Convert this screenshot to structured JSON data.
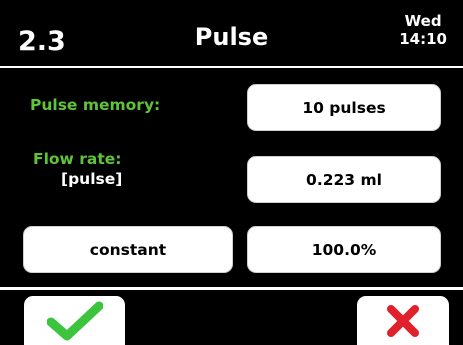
{
  "header": {
    "screen_id": "2.3",
    "title": "Pulse",
    "day": "Wed",
    "time": "14:10"
  },
  "pulse_memory": {
    "label": "Pulse memory:",
    "value": "10 pulses"
  },
  "flow_rate": {
    "label": "Flow rate:",
    "unit_label": "[pulse]",
    "value": "0.223 ml"
  },
  "mode": {
    "value": "constant",
    "percent": "100.0%"
  },
  "footer": {
    "confirm_icon": "checkmark-icon",
    "cancel_icon": "x-icon"
  },
  "colors": {
    "label_green": "#5fc43a",
    "confirm_green": "#3cc43c",
    "cancel_red": "#e0202a"
  }
}
